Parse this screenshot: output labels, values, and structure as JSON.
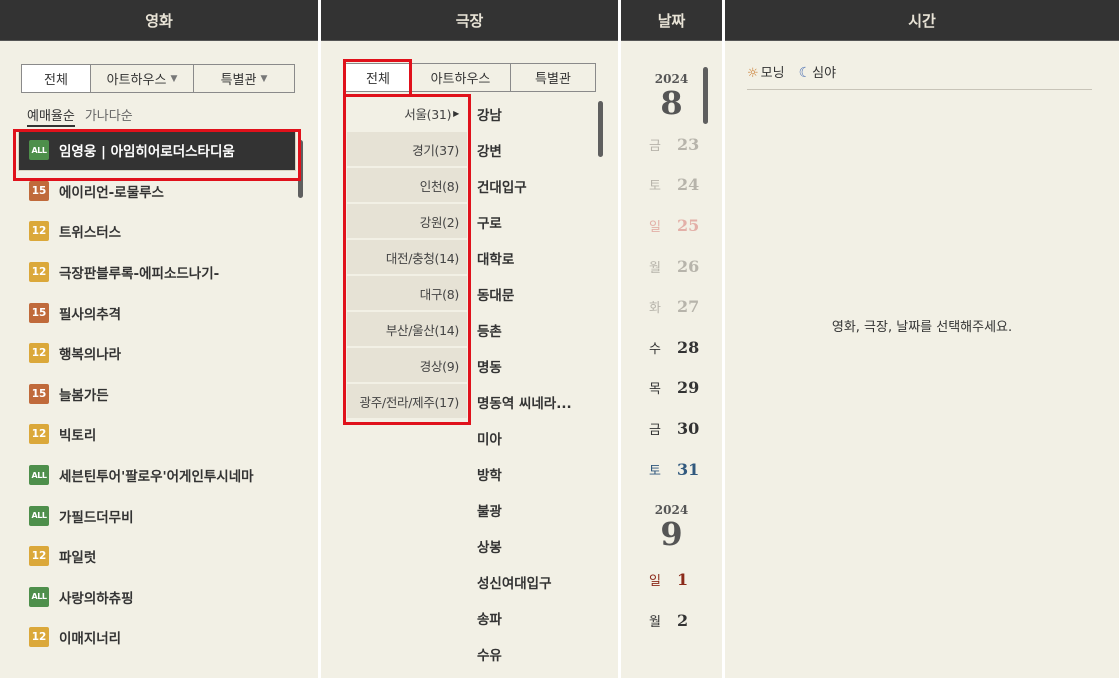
{
  "headers": {
    "movie": "영화",
    "theater": "극장",
    "date": "날짜",
    "time": "시간"
  },
  "movie": {
    "tabs": [
      "전체",
      "아트하우스",
      "특별관"
    ],
    "sort": [
      "예매율순",
      "가나다순"
    ],
    "items": [
      {
        "rating": "ALL",
        "title": "임영웅 | 아임히어로더스타디움"
      },
      {
        "rating": "15",
        "title": "에이리언-로물루스"
      },
      {
        "rating": "12",
        "title": "트위스터스"
      },
      {
        "rating": "12",
        "title": "극장판블루록-에피소드나기-"
      },
      {
        "rating": "15",
        "title": "필사의추격"
      },
      {
        "rating": "12",
        "title": "행복의나라"
      },
      {
        "rating": "15",
        "title": "늘봄가든"
      },
      {
        "rating": "12",
        "title": "빅토리"
      },
      {
        "rating": "ALL",
        "title": "세븐틴투어'팔로우'어게인투시네마"
      },
      {
        "rating": "ALL",
        "title": "가필드더무비"
      },
      {
        "rating": "12",
        "title": "파일럿"
      },
      {
        "rating": "ALL",
        "title": "사랑의하츄핑"
      },
      {
        "rating": "12",
        "title": "이매지너리"
      }
    ]
  },
  "theater": {
    "tabs": [
      "전체",
      "아트하우스",
      "특별관"
    ],
    "regions": [
      "서울(31)",
      "경기(37)",
      "인천(8)",
      "강원(2)",
      "대전/충청(14)",
      "대구(8)",
      "부산/울산(14)",
      "경상(9)",
      "광주/전라/제주(17)"
    ],
    "theaters": [
      "강남",
      "강변",
      "건대입구",
      "구로",
      "대학로",
      "동대문",
      "등촌",
      "명동",
      "명동역 씨네라...",
      "미아",
      "방학",
      "불광",
      "상봉",
      "성신여대입구",
      "송파",
      "수유"
    ]
  },
  "date": {
    "month1": {
      "year": "2024",
      "month": "8"
    },
    "days1": [
      {
        "dow": "금",
        "day": "23",
        "style": "dim"
      },
      {
        "dow": "토",
        "day": "24",
        "style": "dim"
      },
      {
        "dow": "일",
        "day": "25",
        "style": "dim-sun"
      },
      {
        "dow": "월",
        "day": "26",
        "style": "dim"
      },
      {
        "dow": "화",
        "day": "27",
        "style": "dim"
      },
      {
        "dow": "수",
        "day": "28",
        "style": "dark"
      },
      {
        "dow": "목",
        "day": "29",
        "style": "dark"
      },
      {
        "dow": "금",
        "day": "30",
        "style": "dark"
      },
      {
        "dow": "토",
        "day": "31",
        "style": "sat"
      }
    ],
    "month2": {
      "year": "2024",
      "month": "9"
    },
    "days2": [
      {
        "dow": "일",
        "day": "1",
        "style": "sun"
      },
      {
        "dow": "월",
        "day": "2",
        "style": "dark"
      }
    ]
  },
  "time": {
    "legend_morning": "모닝",
    "legend_night": "심야",
    "message": "영화, 극장, 날짜를 선택해주세요."
  }
}
